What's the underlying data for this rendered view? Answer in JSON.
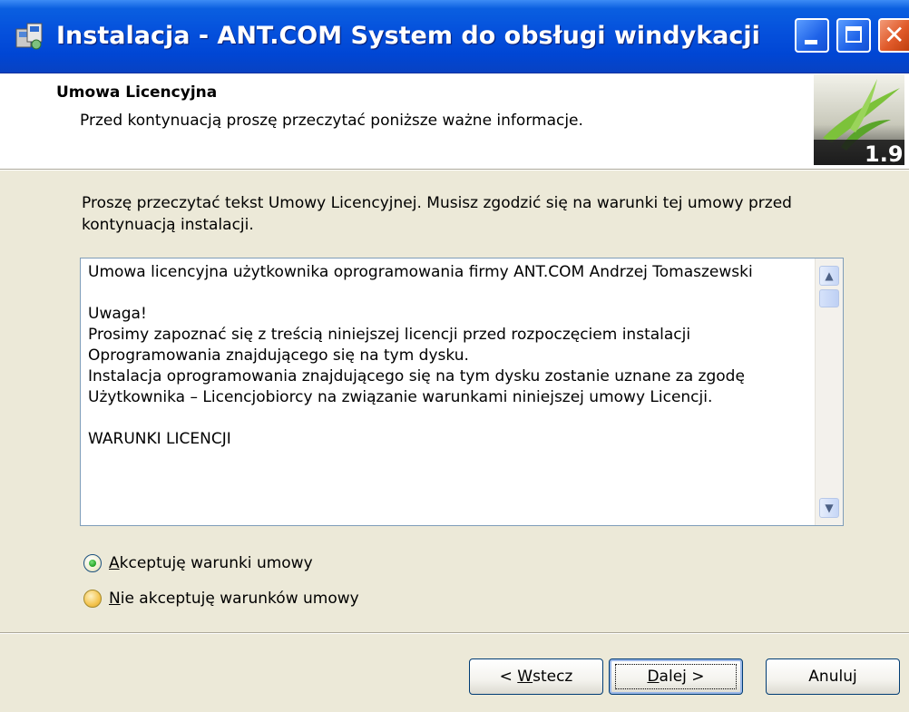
{
  "window": {
    "title": "Instalacja - ANT.COM System do obsługi windykacji",
    "controls": {
      "minimize": "minimize-icon",
      "maximize": "maximize-icon",
      "close": "close-icon"
    }
  },
  "header": {
    "title": "Umowa Licencyjna",
    "subtitle": "Przed kontynuacją proszę przeczytać poniższe ważne informacje.",
    "image_version": "1.9"
  },
  "body": {
    "intro": "Proszę przeczytać tekst Umowy Licencyjnej. Musisz zgodzić się na warunki tej umowy przed kontynuacją instalacji.",
    "license_text": "Umowa licencyjna użytkownika oprogramowania firmy ANT.COM Andrzej Tomaszewski\n\nUwaga!\nProsimy zapoznać się z treścią niniejszej licencji przed rozpoczęciem instalacji Oprogramowania znajdującego się na tym dysku.\nInstalacja oprogramowania znajdującego się na tym dysku zostanie uznane za zgodę Użytkownika – Licencjobiorcy na związanie warunkami niniejszej umowy Licencji.\n\nWARUNKI LICENCJI"
  },
  "options": {
    "accept": {
      "label": "Akceptuję warunki umowy",
      "mnemonic": "A",
      "rest": "kceptuję warunki umowy",
      "checked": true
    },
    "decline": {
      "label": "Nie akceptuję warunków umowy",
      "mnemonic": "N",
      "rest": "ie akceptuję warunków umowy",
      "checked": false
    }
  },
  "buttons": {
    "back": {
      "label": "< Wstecz",
      "prefix": "< ",
      "mnemonic": "W",
      "rest": "stecz"
    },
    "next": {
      "label": "Dalej >",
      "mnemonic": "D",
      "rest": "alej >"
    },
    "cancel": {
      "label": "Anuluj"
    }
  },
  "colors": {
    "titlebar": "#0550DC",
    "dialog_background": "#ECE9D8",
    "close_button": "#E05A2A"
  }
}
